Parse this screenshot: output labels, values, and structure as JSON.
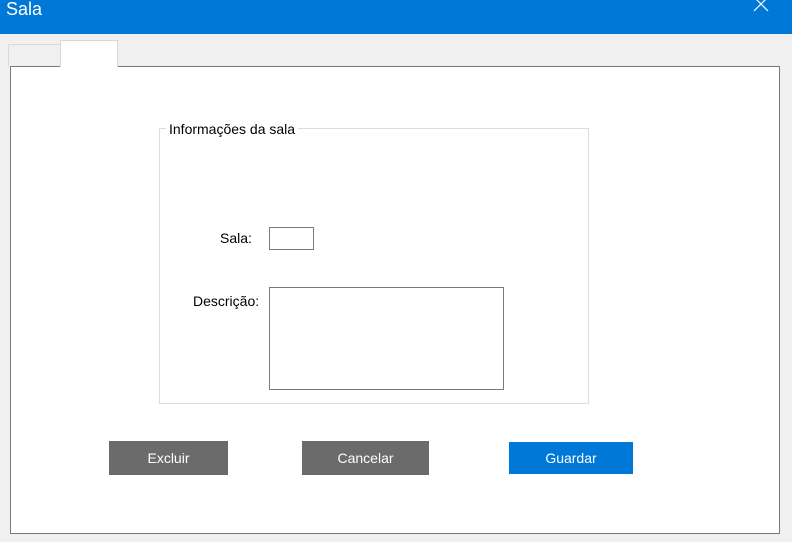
{
  "window": {
    "title": "Sala",
    "accent_color": "#0078d7",
    "close_icon": "close-icon"
  },
  "tabs": [
    {
      "label": "",
      "selected": false
    },
    {
      "label": "",
      "selected": true
    }
  ],
  "group": {
    "title": "Informações da sala"
  },
  "fields": {
    "sala_label": "Sala:",
    "sala_value": "",
    "descricao_label": "Descrição:",
    "descricao_value": ""
  },
  "buttons": {
    "excluir": "Excluir",
    "cancelar": "Cancelar",
    "guardar": "Guardar",
    "secondary_color": "#6b6b6b",
    "primary_color": "#0078d7"
  }
}
